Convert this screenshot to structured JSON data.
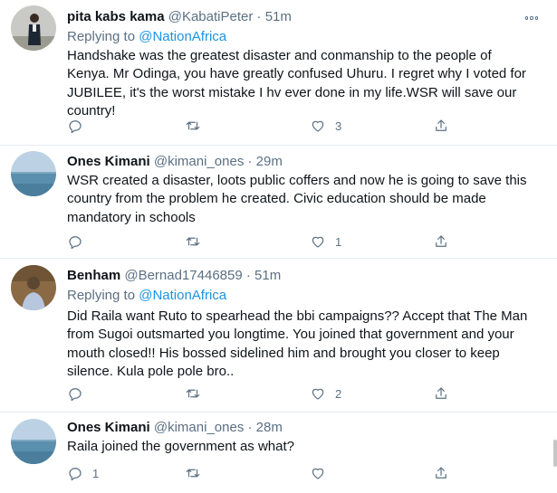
{
  "tweets": [
    {
      "name": "pita kabs kama",
      "handle": "@KabatiPeter",
      "time": "51m",
      "reply_prefix": "Replying to",
      "reply_to": "@NationAfrica",
      "lines": [
        "Handshake was the greatest disaster and conmanship to the people of",
        "Kenya. Mr Odinga, you have greatly confused Uhuru. I regret why I voted for",
        "JUBILEE, it's the worst mistake I hv ever done in my life.WSR  will save our",
        "country!"
      ],
      "reply_count": "",
      "retweet_count": "",
      "like_count": "3",
      "avatar_icon": "user-photo-avatar"
    },
    {
      "name": "Ones Kimani",
      "handle": "@kimani_ones",
      "time": "29m",
      "lines": [
        "WSR created a disaster, loots public coffers and now he is going to save this",
        "country from the problem he created. Civic education should be made",
        "mandatory in schools"
      ],
      "reply_count": "",
      "retweet_count": "",
      "like_count": "1",
      "avatar_icon": "sea-photo-avatar"
    },
    {
      "name": "Benham",
      "handle": "@Bernad17446859",
      "time": "51m",
      "reply_prefix": "Replying to",
      "reply_to": "@NationAfrica",
      "lines": [
        "Did Raila want Ruto to spearhead the bbi campaigns?? Accept that The Man",
        "from Sugoi outsmarted you longtime. You joined that government and your",
        "mouth closed!! His bossed sidelined him and brought you closer to keep",
        "silence. Kula  pole pole bro.."
      ],
      "reply_count": "",
      "retweet_count": "",
      "like_count": "2",
      "avatar_icon": "user-photo-avatar"
    },
    {
      "name": "Ones Kimani",
      "handle": "@kimani_ones",
      "time": "28m",
      "lines": [
        "Raila joined the government as what?"
      ],
      "reply_count": "1",
      "retweet_count": "",
      "like_count": "",
      "avatar_icon": "sea-photo-avatar"
    }
  ],
  "separator": " · ",
  "icons": [
    "more-icon",
    "reply-icon",
    "retweet-icon",
    "like-icon",
    "share-icon"
  ],
  "colors": {
    "text": "#0f1419",
    "secondary": "#5b7083",
    "link": "#1b95e0",
    "border": "#e6ecf0"
  }
}
